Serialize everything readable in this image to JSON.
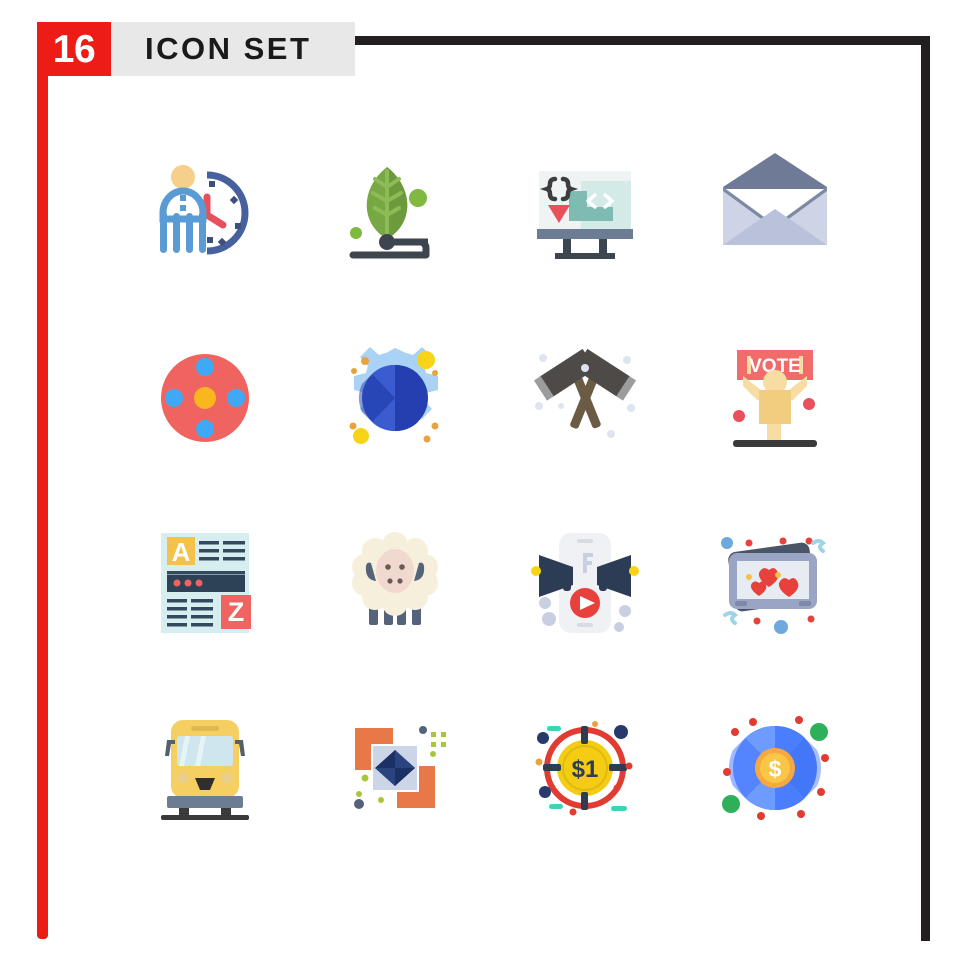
{
  "header": {
    "count": "16",
    "title": "ICON SET",
    "count_bg": "#ed1c16",
    "band_bg": "#e8e8e8",
    "title_color": "#1a1a1a"
  },
  "frame": {
    "border_color": "#231f20",
    "accent_color": "#ed1c16"
  },
  "grid": {
    "rows": 4,
    "columns": 4,
    "total": 16
  },
  "icons": [
    {
      "id": "person-clock",
      "label": "Person with clock",
      "row": 1,
      "col": 1,
      "colors": {
        "body": "#5b9bd5",
        "head": "#f6cf8a",
        "clock": "#46619d",
        "hand": "#e8505b"
      }
    },
    {
      "id": "eco-leaf-circuit",
      "label": "Leaf with circuit",
      "row": 1,
      "col": 2,
      "colors": {
        "leaf": "#78a843",
        "leaf_dark": "#6d9a3c",
        "circuit": "#3d454f",
        "dot": "#7fb93f"
      }
    },
    {
      "id": "monitor-code",
      "label": "Monitor with code brackets",
      "row": 1,
      "col": 3,
      "colors": {
        "screen": "#eff3f4",
        "stand": "#6b7c93",
        "teal": "#7fbab3",
        "teal_light": "#d3eae7",
        "brackets": "#3d3d3d",
        "arrow": "#e8505b"
      }
    },
    {
      "id": "open-envelope",
      "label": "Open envelope mail",
      "row": 1,
      "col": 4,
      "colors": {
        "flap": "#6f7b96",
        "body": "#ced4e6",
        "front": "#b9c2da"
      }
    },
    {
      "id": "atom-molecule",
      "label": "Atom molecule",
      "row": 2,
      "col": 1,
      "colors": {
        "base": "#ef6461",
        "node": "#3fa9f5",
        "core": "#f9b61e"
      }
    },
    {
      "id": "globe-gear",
      "label": "Globe in gear",
      "row": 2,
      "col": 2,
      "colors": {
        "gear": "#a9d2f5",
        "globe": "#2440b0",
        "globe_light": "#3b5bd0",
        "dot_yellow": "#f7d417"
      }
    },
    {
      "id": "crossed-hammers",
      "label": "Crossed hammers",
      "row": 2,
      "col": 3,
      "colors": {
        "head": "#4d4a47",
        "tip": "#9c9c9c",
        "handle": "#6b5b44",
        "speck": "#dfe4f2"
      }
    },
    {
      "id": "vote-banner",
      "label": "Person holding vote banner",
      "row": 2,
      "col": 4,
      "text": "VOTE",
      "colors": {
        "banner": "#f26b6b",
        "person": "#f7dda3",
        "ground": "#3a3a3a",
        "dot": "#e8505b"
      }
    },
    {
      "id": "dictionary-a-z",
      "label": "Dictionary A to Z document",
      "row": 3,
      "col": 1,
      "text_a": "A",
      "text_z": "Z",
      "colors": {
        "page": "#d7eef0",
        "bar": "#2e4257",
        "a_box": "#f3c24b",
        "z_box": "#ef6461",
        "line": "#34495e"
      }
    },
    {
      "id": "sheep",
      "label": "Sheep",
      "row": 3,
      "col": 2,
      "colors": {
        "wool": "#f6efdc",
        "face": "#f2d9d0",
        "leg": "#54627a",
        "ear": "#54627a"
      }
    },
    {
      "id": "phone-megaphone",
      "label": "Phone with megaphones",
      "row": 3,
      "col": 3,
      "colors": {
        "phone": "#eff1f4",
        "horn": "#2d3c55",
        "play": "#e8403a",
        "dot": "#c9cfe0"
      }
    },
    {
      "id": "photos-hearts",
      "label": "Photo cards with hearts",
      "row": 3,
      "col": 4,
      "colors": {
        "card_back": "#4a5568",
        "card_front": "#9aa4c4",
        "screen": "#e7ebf2",
        "heart": "#e8403a",
        "confetti": "#6fa8dc"
      }
    },
    {
      "id": "school-bus",
      "label": "School bus",
      "row": 4,
      "col": 1,
      "colors": {
        "body": "#f6cf63",
        "window": "#cfe6ee",
        "mirror": "#55606e",
        "wheel": "#3a3a3a",
        "bumper": "#6b7c93"
      }
    },
    {
      "id": "diamond-frame",
      "label": "Diamond in focus frame",
      "row": 4,
      "col": 2,
      "colors": {
        "bracket": "#e87847",
        "panel": "#ccd5e8",
        "diamond": "#1b3064",
        "speck_green": "#a8c63c"
      }
    },
    {
      "id": "dollar-target",
      "label": "Dollar coin target",
      "row": 4,
      "col": 3,
      "text": "$1",
      "colors": {
        "ring": "#e03c31",
        "coin": "#f4cc14",
        "tick": "#2e3d4f",
        "teal": "#3fd2b4",
        "navy": "#263a6b"
      }
    },
    {
      "id": "globe-dollar",
      "label": "Globe with dollar coin",
      "row": 4,
      "col": 4,
      "text": "$",
      "colors": {
        "globe": "#4a7dff",
        "globe_light": "#6e9bff",
        "coin": "#f7a940",
        "coin_inner": "#f9c648",
        "dot_red": "#e03c31",
        "dot_green": "#2eb05a"
      }
    }
  ]
}
